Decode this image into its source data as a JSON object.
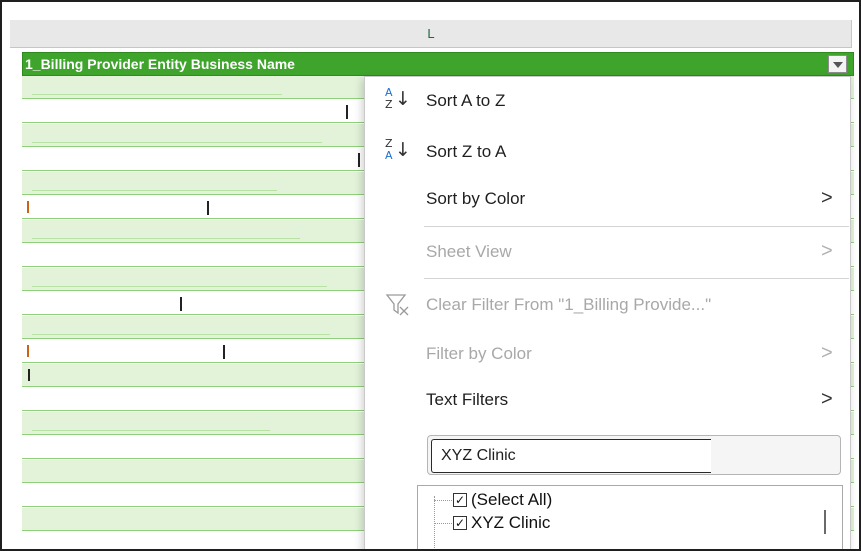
{
  "column": {
    "letter": "L"
  },
  "header": {
    "label": "1_Billing Provider Entity Business Name",
    "next_col": "1"
  },
  "menu": {
    "sort_az": {
      "label": "Sort A to Z",
      "icon": "sort-ascending-icon",
      "top_letter": "A",
      "bottom_letter": "Z"
    },
    "sort_za": {
      "label": "Sort Z to A",
      "icon": "sort-descending-icon",
      "top_letter": "Z",
      "bottom_letter": "A"
    },
    "sort_by_color": {
      "label": "Sort by Color"
    },
    "sheet_view": {
      "label": "Sheet View"
    },
    "clear_filter": {
      "label": "Clear Filter From \"1_Billing Provide...\"",
      "icon": "clear-filter-icon"
    },
    "filter_by_color": {
      "label": "Filter by Color"
    },
    "text_filters": {
      "label": "Text Filters"
    },
    "submenu_glyph": ">"
  },
  "search": {
    "value": "XYZ Clinic"
  },
  "list": {
    "items": [
      {
        "label": "(Select All)",
        "checked": true
      },
      {
        "label": "XYZ Clinic",
        "checked": true
      }
    ],
    "check_glyph": "✓"
  },
  "colors": {
    "header_green": "#3fa42b",
    "band_green": "#e2f3da",
    "accent_blue": "#1d6fd1",
    "disabled_text": "#a8a8a8"
  }
}
